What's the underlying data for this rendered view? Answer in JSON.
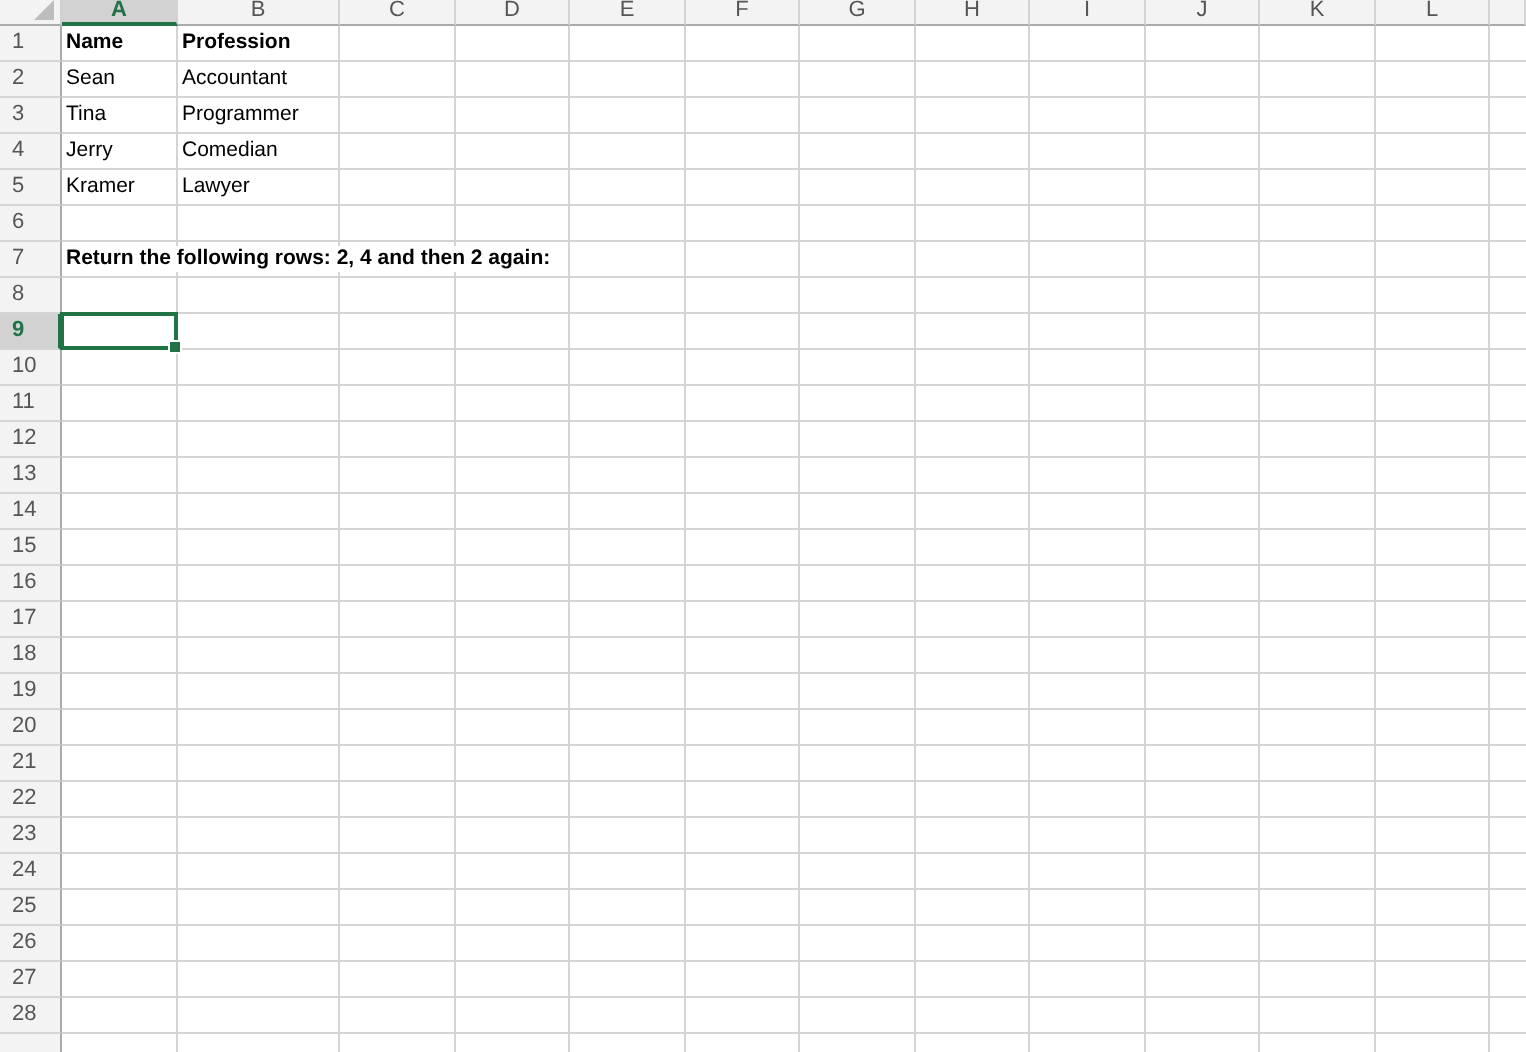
{
  "columns": [
    {
      "label": "A",
      "selected": true
    },
    {
      "label": "B",
      "selected": false
    },
    {
      "label": "C",
      "selected": false
    },
    {
      "label": "D",
      "selected": false
    },
    {
      "label": "E",
      "selected": false
    },
    {
      "label": "F",
      "selected": false
    },
    {
      "label": "G",
      "selected": false
    },
    {
      "label": "H",
      "selected": false
    },
    {
      "label": "I",
      "selected": false
    },
    {
      "label": "J",
      "selected": false
    },
    {
      "label": "K",
      "selected": false
    },
    {
      "label": "L",
      "selected": false
    }
  ],
  "rows": [
    {
      "number": "1",
      "selected": false,
      "bold": true,
      "cells": [
        "Name",
        "Profession"
      ]
    },
    {
      "number": "2",
      "selected": false,
      "bold": false,
      "cells": [
        "Sean",
        "Accountant"
      ]
    },
    {
      "number": "3",
      "selected": false,
      "bold": false,
      "cells": [
        "Tina",
        "Programmer"
      ]
    },
    {
      "number": "4",
      "selected": false,
      "bold": false,
      "cells": [
        "Jerry",
        "Comedian"
      ]
    },
    {
      "number": "5",
      "selected": false,
      "bold": false,
      "cells": [
        "Kramer",
        "Lawyer"
      ]
    },
    {
      "number": "6",
      "selected": false
    },
    {
      "number": "7",
      "selected": false,
      "bold": true,
      "cells": [
        "Return the following rows: 2, 4 and then 2 again:"
      ]
    },
    {
      "number": "8",
      "selected": false
    },
    {
      "number": "9",
      "selected": true
    },
    {
      "number": "10",
      "selected": false
    },
    {
      "number": "11",
      "selected": false
    },
    {
      "number": "12",
      "selected": false
    },
    {
      "number": "13",
      "selected": false
    },
    {
      "number": "14",
      "selected": false
    },
    {
      "number": "15",
      "selected": false
    },
    {
      "number": "16",
      "selected": false
    },
    {
      "number": "17",
      "selected": false
    },
    {
      "number": "18",
      "selected": false
    },
    {
      "number": "19",
      "selected": false
    },
    {
      "number": "20",
      "selected": false
    },
    {
      "number": "21",
      "selected": false
    },
    {
      "number": "22",
      "selected": false
    },
    {
      "number": "23",
      "selected": false
    },
    {
      "number": "24",
      "selected": false
    },
    {
      "number": "25",
      "selected": false
    },
    {
      "number": "26",
      "selected": false
    },
    {
      "number": "27",
      "selected": false
    },
    {
      "number": "28",
      "selected": false
    }
  ]
}
